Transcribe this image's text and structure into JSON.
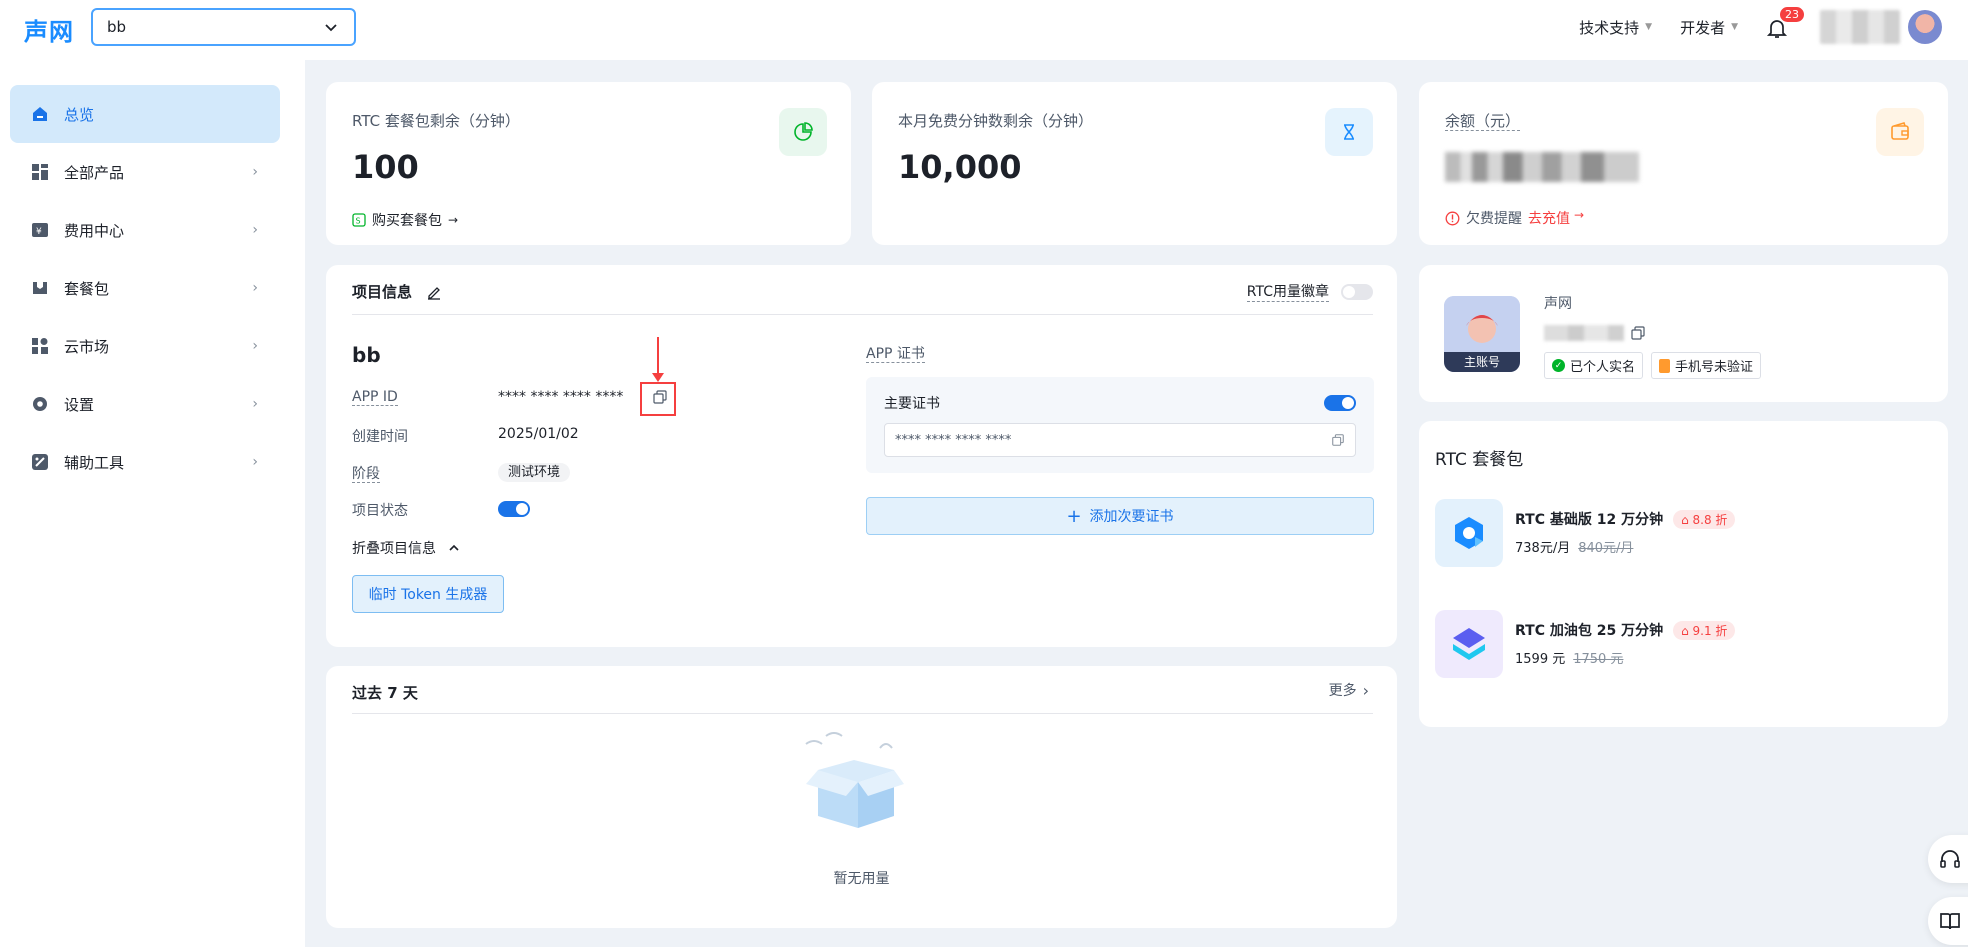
{
  "header": {
    "logo": "声网",
    "project_select_value": "bb",
    "tech_support": "技术支持",
    "developer": "开发者",
    "notification_count": "23"
  },
  "sidebar": {
    "items": [
      {
        "label": "总览",
        "icon": "home-icon",
        "active": true
      },
      {
        "label": "全部产品",
        "icon": "grid-icon"
      },
      {
        "label": "费用中心",
        "icon": "billing-icon"
      },
      {
        "label": "套餐包",
        "icon": "package-icon"
      },
      {
        "label": "云市场",
        "icon": "market-icon"
      },
      {
        "label": "设置",
        "icon": "gear-icon"
      },
      {
        "label": "辅助工具",
        "icon": "tool-icon"
      }
    ]
  },
  "stats": {
    "rtc_pkg_label": "RTC 套餐包剩余（分钟）",
    "rtc_pkg_value": "100",
    "buy_pkg_link": "购买套餐包",
    "free_min_label": "本月免费分钟数剩余（分钟）",
    "free_min_value": "10,000",
    "balance_label": "余额（元）",
    "arrears_text": "欠费提醒",
    "recharge_link": "去充值"
  },
  "project_info": {
    "title": "项目信息",
    "rtc_badge_label": "RTC用量徽章",
    "name": "bb",
    "app_id_label": "APP ID",
    "app_id_value": "**** **** **** ****",
    "created_label": "创建时间",
    "created_value": "2025/01/02",
    "stage_label": "阶段",
    "stage_value": "测试环境",
    "status_label": "项目状态",
    "collapse_label": "折叠项目信息",
    "token_button": "临时 Token 生成器",
    "cert_title": "APP 证书",
    "primary_cert_label": "主要证书",
    "primary_cert_value": "**** **** **** ****",
    "add_cert_button": "添加次要证书"
  },
  "usage": {
    "title": "过去 7 天",
    "more_link": "更多",
    "empty_text": "暂无用量"
  },
  "account": {
    "name": "声网",
    "avatar_tag": "主账号",
    "verified_tag": "已个人实名",
    "phone_tag": "手机号未验证"
  },
  "packages": {
    "title": "RTC 套餐包",
    "items": [
      {
        "name": "RTC 基础版 12 万分钟",
        "discount": "8.8 折",
        "price": "738元/月",
        "old_price": "840元/月"
      },
      {
        "name": "RTC 加油包 25 万分钟",
        "discount": "9.1 折",
        "price": "1599 元",
        "old_price": "1750 元"
      }
    ]
  },
  "colors": {
    "primary": "#1a73e8",
    "danger": "#f53f3f",
    "active_bg": "#d3e9fb"
  }
}
